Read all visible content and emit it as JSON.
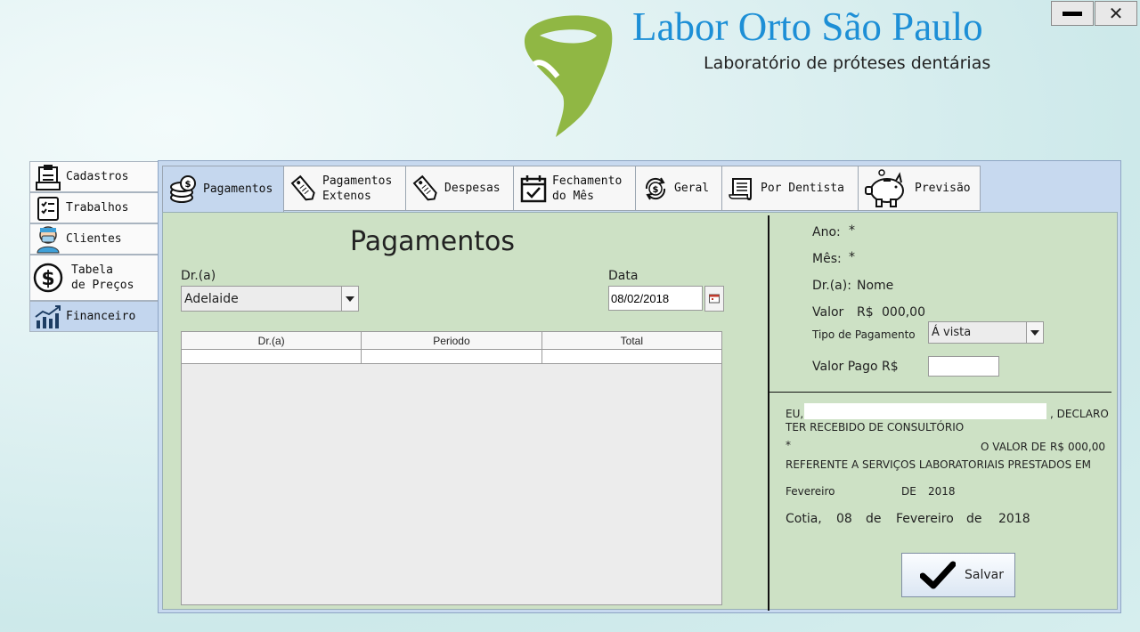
{
  "window": {
    "minimize_icon": "minimize-icon",
    "close_label": "✕"
  },
  "brand": {
    "title": "Labor Orto São Paulo",
    "subtitle": "Laboratório de próteses dentárias",
    "accent": "#1d8fd6",
    "logo_color": "#8bb33a"
  },
  "sidebar": {
    "items": [
      {
        "label": "Cadastros",
        "icon": "clipboard-icon"
      },
      {
        "label": "Trabalhos",
        "icon": "checklist-icon"
      },
      {
        "label": "Clientes",
        "icon": "dentist-icon"
      },
      {
        "label_line1": "Tabela",
        "label_line2": "de Preços",
        "icon": "dollar-icon"
      },
      {
        "label": "Financeiro",
        "icon": "chart-icon"
      }
    ]
  },
  "tabs": [
    {
      "label": "Pagamentos",
      "icon": "coins-icon"
    },
    {
      "label_line1": "Pagamentos",
      "label_line2": "Extenos",
      "icon": "price-tag-icon"
    },
    {
      "label": "Despesas",
      "icon": "price-tag-icon"
    },
    {
      "label_line1": "Fechamento",
      "label_line2": "do Mês",
      "icon": "calendar-check-icon"
    },
    {
      "label": "Geral",
      "icon": "cycle-dollar-icon"
    },
    {
      "label": "Por Dentista",
      "icon": "receipt-icon"
    },
    {
      "label": "Previsão",
      "icon": "piggy-bank-icon"
    }
  ],
  "form": {
    "title": "Pagamentos",
    "doctor_label": "Dr.(a)",
    "doctor_value": "Adelaide",
    "date_label": "Data",
    "date_value": "08/02/2018"
  },
  "grid": {
    "columns": [
      "Dr.(a)",
      "Periodo",
      "Total"
    ]
  },
  "summary": {
    "ano_label": "Ano:",
    "ano_value": "*",
    "mes_label": "Mês:",
    "mes_value": "*",
    "dr_label": "Dr.(a):",
    "dr_value": "Nome",
    "valor_label": "Valor",
    "valor_currency": "R$",
    "valor_value": "000,00",
    "tipo_label": "Tipo de Pagamento",
    "tipo_value": "Á vista",
    "valor_pago_label": "Valor Pago R$",
    "valor_pago_value": ""
  },
  "receipt": {
    "eu": "EU,",
    "declaro": ", DECLARO",
    "line2": "TER RECEBIDO DE CONSULTÓRIO",
    "star": "*",
    "o_valor": "O VALOR DE",
    "currency": "R$",
    "amount": "000,00",
    "line4": "REFERENTE A SERVIÇOS LABORATORIAIS PRESTADOS EM",
    "month": "Fevereiro",
    "de_upper": "DE",
    "year": "2018",
    "city": "Cotia,",
    "day": "08",
    "de1": "de",
    "month2": "Fevereiro",
    "de2": "de",
    "year2": "2018"
  },
  "save_button": {
    "label": "Salvar",
    "icon": "checkmark-icon"
  }
}
